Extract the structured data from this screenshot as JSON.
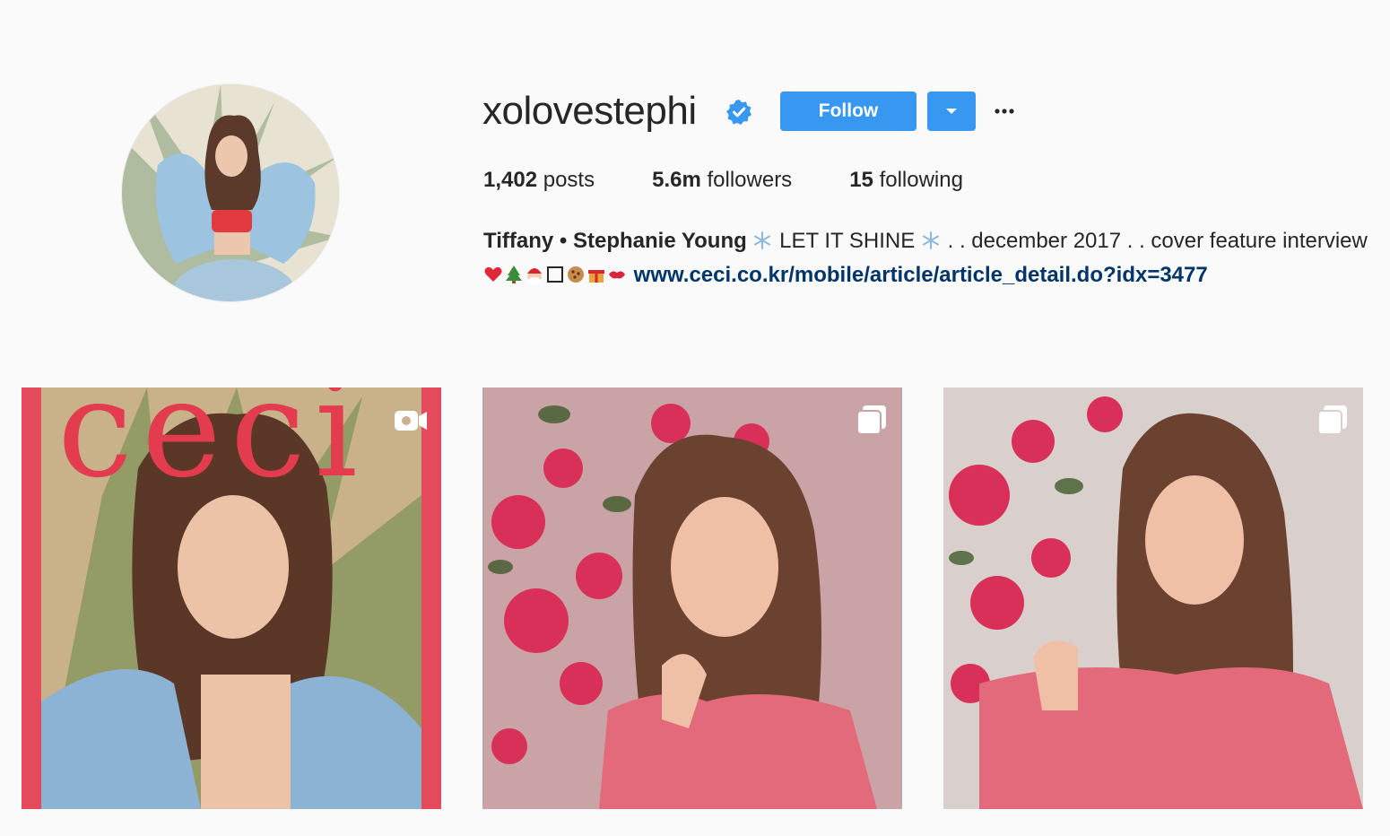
{
  "profile": {
    "username": "xolovestephi",
    "verified": true,
    "follow_label": "Follow",
    "stats": {
      "posts_count": "1,402",
      "posts_label": "posts",
      "followers_count": "5.6m",
      "followers_label": "followers",
      "following_count": "15",
      "following_label": "following"
    },
    "bio": {
      "name": "Tiffany • Stephanie Young",
      "text_1": "LET IT SHINE",
      "text_2": ". . december 2017 . . cover feature interview",
      "link": "www.ceci.co.kr/mobile/article/article_detail.do?idx=3477"
    }
  },
  "posts": [
    {
      "type_icon": "video-icon",
      "cover_text": "ceci"
    },
    {
      "type_icon": "carousel-icon"
    },
    {
      "type_icon": "carousel-icon"
    }
  ],
  "colors": {
    "accent": "#3897f0",
    "link": "#003569",
    "background": "#fafafa",
    "text": "#262626"
  }
}
